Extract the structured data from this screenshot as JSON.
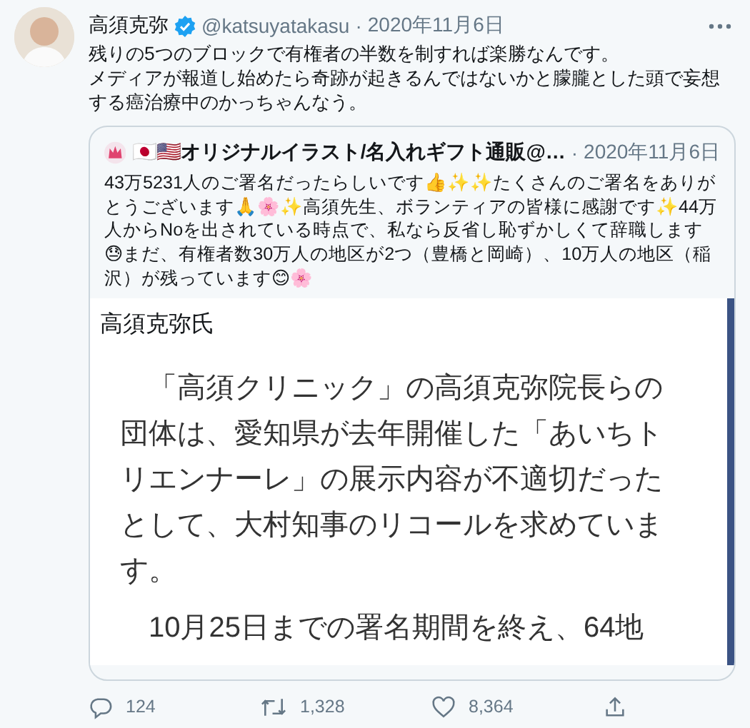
{
  "tweet": {
    "author": "高須克弥",
    "verified": true,
    "handle": "@katsuyatakasu",
    "separator": "·",
    "date": "2020年11月6日",
    "paragraphs": [
      "残りの5つのブロックで有権者の半数を制すれば楽勝なんです。",
      "メディアが報道し始めたら奇跡が起きるんではないかと朦朧とした頭で妄想する癌治療中のかっちゃんなう。"
    ],
    "quote": {
      "author": "🇯🇵🇺🇸オリジナルイラスト/名入れギフト通販@…",
      "separator": "·",
      "date": "2020年11月6日",
      "text": "43万5231人のご署名だったらしいです👍✨✨たくさんのご署名をありがとうございます🙏🌸✨高須先生、ボランティアの皆様に感謝です✨44万人からNoを出されている時点で、私なら反省し恥ずかしくて辞職します😓まだ、有権者数30万人の地区が2つ（豊橋と岡崎）、10万人の地区（稲沢）が残っています😊🌸",
      "image": {
        "caption": "高須克弥氏",
        "paragraphs": [
          "「高須クリニック」の高須克弥院長らの団体は、愛知県が去年開催した「あいちトリエンナーレ」の展示内容が不適切だったとして、大村知事のリコールを求めています。",
          "10月25日までの署名期間を終え、64地"
        ]
      }
    },
    "actions": [
      {
        "kind": "reply",
        "count": "124"
      },
      {
        "kind": "retweet",
        "count": "1,328"
      },
      {
        "kind": "like",
        "count": "8,364"
      },
      {
        "kind": "share"
      }
    ]
  }
}
